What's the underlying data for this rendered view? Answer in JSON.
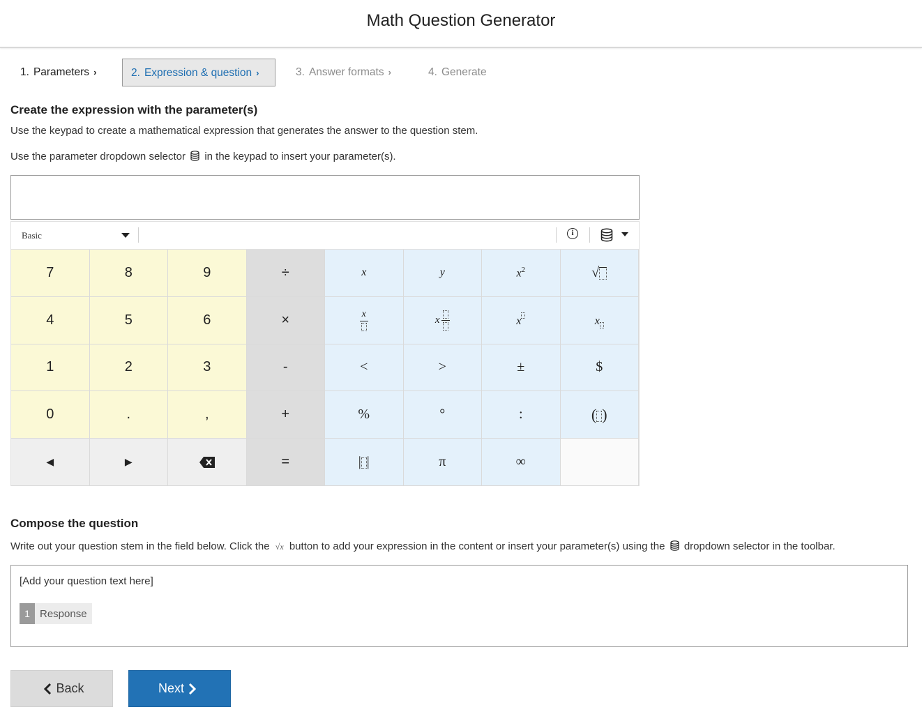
{
  "app": {
    "title": "Math Question Generator"
  },
  "steps": [
    {
      "num": "1.",
      "label": "Parameters"
    },
    {
      "num": "2.",
      "label": "Expression & question"
    },
    {
      "num": "3.",
      "label": "Answer formats"
    },
    {
      "num": "4.",
      "label": "Generate"
    }
  ],
  "expression_section": {
    "heading": "Create the expression with the parameter(s)",
    "line1": "Use the keypad to create a mathematical expression that generates the answer to the question stem.",
    "line2_before": "Use the parameter dropdown selector",
    "line2_after": "in the keypad to insert your parameter(s).",
    "input_value": ""
  },
  "keypad": {
    "mode": "Basic",
    "keys": {
      "k7": "7",
      "k8": "8",
      "k9": "9",
      "divide": "÷",
      "x": "x",
      "y": "y",
      "k4": "4",
      "k5": "5",
      "k6": "6",
      "times": "×",
      "k1": "1",
      "k2": "2",
      "k3": "3",
      "minus": "-",
      "less": "<",
      "greater": ">",
      "plusminus": "±",
      "dollar": "$",
      "k0": "0",
      "decimal": ".",
      "comma": ",",
      "plus": "+",
      "percent": "%",
      "degree": "°",
      "colon": ":",
      "equals": "=",
      "pi": "π",
      "infinity": "∞"
    }
  },
  "compose_section": {
    "heading": "Compose the question",
    "line_before": "Write out your question stem in the field below. Click the",
    "sqrt_symbol": "√x",
    "line_middle": "button to add your expression in the content or insert your parameter(s) using the",
    "line_after": "dropdown selector in the toolbar.",
    "placeholder": "[Add your question text here]",
    "response_num": "1",
    "response_label": "Response"
  },
  "buttons": {
    "back": "Back",
    "next": "Next"
  },
  "colors": {
    "accent": "#2272b5",
    "numpad": "#fbf9d6",
    "operator": "#dddddd",
    "function": "#e4f1fb"
  },
  "icons": [
    "info-icon",
    "database-icon",
    "chevron-right-icon",
    "chevron-left-icon",
    "backspace-icon",
    "arrow-left-icon",
    "arrow-right-icon",
    "caret-down-icon"
  ]
}
